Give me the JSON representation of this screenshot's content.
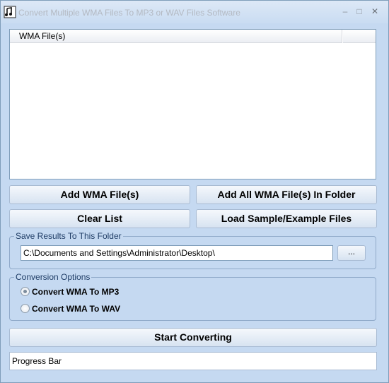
{
  "window": {
    "title": "Convert Multiple WMA Files To MP3 or WAV Files Software",
    "minimize_glyph": "–",
    "maximize_glyph": "□",
    "close_glyph": "✕"
  },
  "file_list": {
    "column_header": "WMA File(s)",
    "items": []
  },
  "buttons": {
    "add_files": "Add WMA File(s)",
    "add_folder": "Add All WMA File(s) In Folder",
    "clear_list": "Clear List",
    "load_samples": "Load Sample/Example Files",
    "browse": "...",
    "start": "Start Converting"
  },
  "save_folder": {
    "group_label": "Save Results To This Folder",
    "path": "C:\\Documents and Settings\\Administrator\\Desktop\\"
  },
  "conversion": {
    "group_label": "Conversion Options",
    "options": [
      {
        "label": "Convert WMA To MP3",
        "selected": true
      },
      {
        "label": "Convert WMA To WAV",
        "selected": false
      }
    ]
  },
  "progress": {
    "label": "Progress Bar"
  },
  "colors": {
    "window_bg": "#c5d9f1",
    "border": "#7f9db9"
  }
}
